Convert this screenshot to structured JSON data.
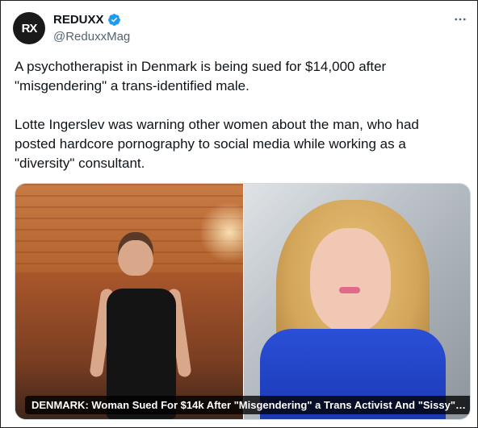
{
  "account": {
    "avatar_text": "RX",
    "display_name": "REDUXX",
    "handle": "@ReduxxMag",
    "verified": true,
    "verified_color": "#1d9bf0"
  },
  "tweet": {
    "paragraphs": [
      "A psychotherapist in Denmark is being sued for $14,000 after \"misgendering\" a trans-identified male.",
      "Lotte Ingerslev was warning other women about the man, who had posted hardcore pornography to social media while working as a \"diversity\" consultant."
    ]
  },
  "media": {
    "caption": "DENMARK: Woman Sued For $14k After \"Misgendering\" a Trans Activist And \"Sissy\" Fe..."
  },
  "icons": {
    "more": "more-horizontal-icon",
    "verified": "verified-badge-icon"
  },
  "colors": {
    "text": "#0f1419",
    "secondary": "#536471",
    "accent": "#1d9bf0"
  }
}
